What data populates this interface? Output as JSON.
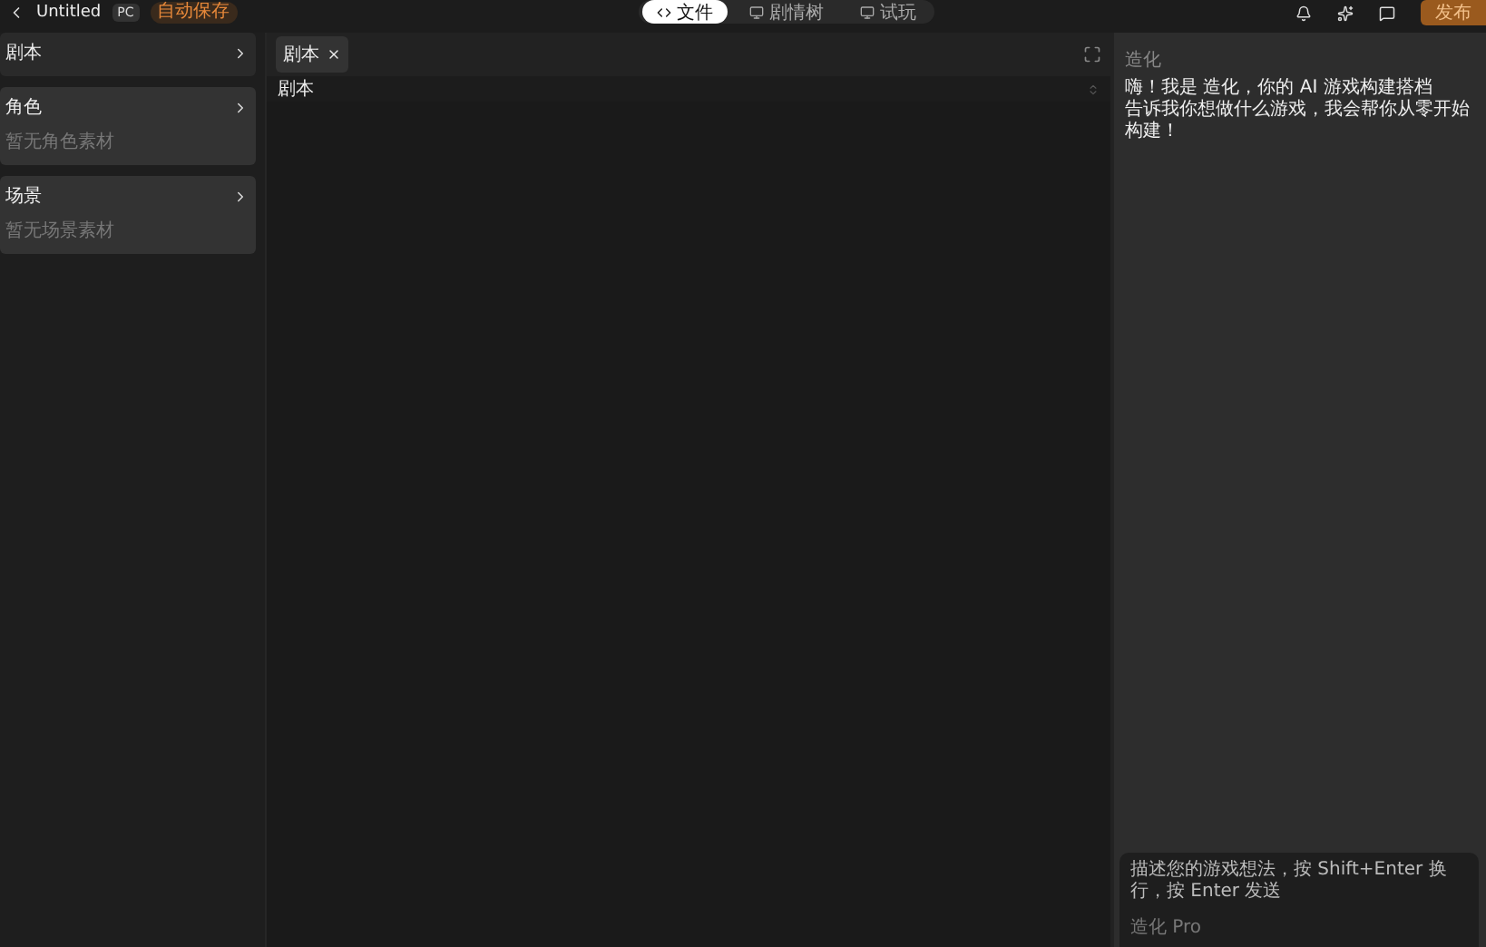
{
  "header": {
    "title": "Untitled",
    "platform": "PC",
    "status": "自动保存",
    "publish": "发布"
  },
  "view_tabs": [
    {
      "label": "文件",
      "kind": "code",
      "selected": true
    },
    {
      "label": "剧情树",
      "kind": "preview",
      "selected": false
    },
    {
      "label": "试玩",
      "kind": "preview",
      "selected": false
    }
  ],
  "sidebar": {
    "items": [
      {
        "title": "剧本"
      },
      {
        "title": "角色",
        "empty": "暂无角色素材"
      },
      {
        "title": "场景",
        "empty": "暂无场景素材"
      }
    ]
  },
  "editor": {
    "tabs": [
      {
        "label": "剧本",
        "selected": true
      }
    ],
    "doc_title": "剧本"
  },
  "assistant": {
    "name": "造化",
    "messages": [
      "嗨！我是 造化，你的 AI 游戏构建搭档",
      "告诉我你想做什么游戏，我会帮你从零开始构建！"
    ],
    "input": {
      "placeholder": "描述您的游戏想法，按 Shift+Enter 换行，按 Enter 发送"
    },
    "model": "造化 Pro"
  }
}
